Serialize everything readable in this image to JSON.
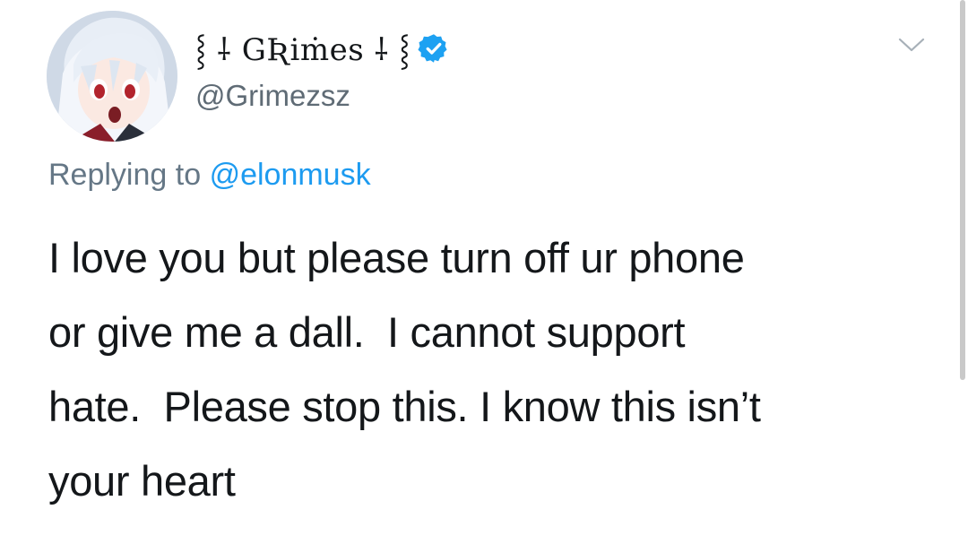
{
  "tweet": {
    "author": {
      "display_name": "⸾ ⸸ GƦiṁes ⸸ ⸾",
      "handle": "@Grimezsz",
      "verified": true,
      "avatar_icon": "anime-avatar-icon"
    },
    "reply_prefix": "Replying to",
    "reply_to": "@elonmusk",
    "body_lines": [
      "I love you but please turn off ur phone",
      "or give me a dall.  I cannot support",
      "hate.  Please stop this. I know this isn’t",
      "your heart"
    ],
    "more_icon": "chevron-down-icon"
  },
  "colors": {
    "link": "#1d9bf0",
    "verified": "#1da1f2",
    "muted": "#657786",
    "text": "#14171a"
  }
}
